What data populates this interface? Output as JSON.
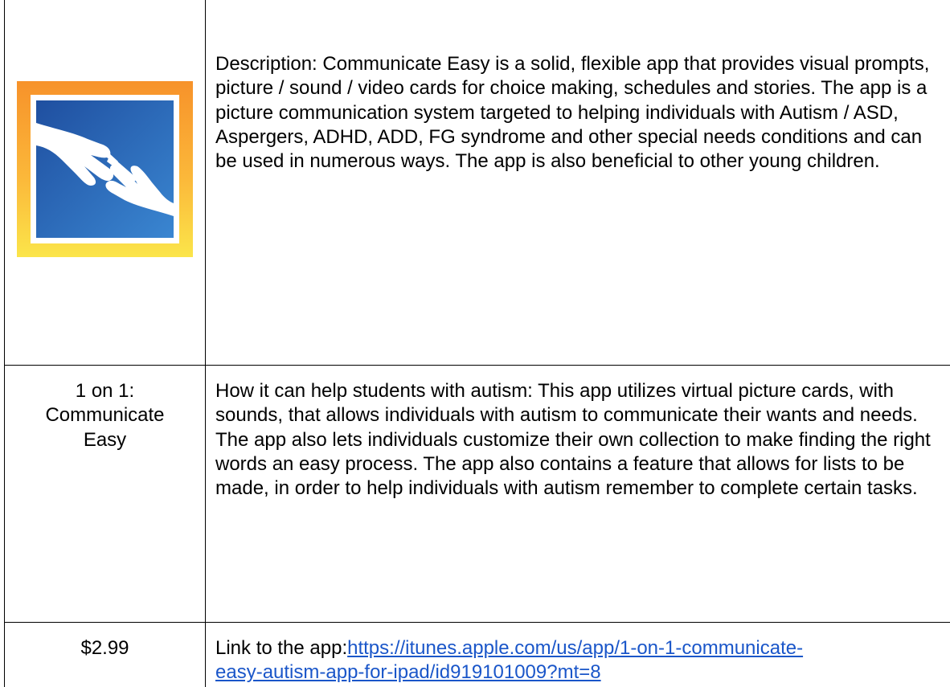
{
  "row1": {
    "icon": "communicate-easy-app-icon",
    "description": "Description: Communicate Easy is a solid, flexible app that provides visual prompts, picture / sound / video cards for choice making, schedules and stories. The app is a picture communication system targeted to helping individuals with Autism / ASD, Aspergers, ADHD, ADD, FG syndrome and other special needs conditions and can be used in numerous ways. The app is also beneficial to other young children."
  },
  "row2": {
    "app_name_line1": "1 on 1:",
    "app_name_line2": "Communicate",
    "app_name_line3": "Easy",
    "how_it_helps": "How it can help students with autism: This app utilizes virtual picture cards, with sounds, that allows individuals with autism to communicate their wants and needs. The app also lets individuals customize their own collection to make finding the right words an easy process. The app also contains a feature that allows for lists to be made, in order to help individuals with autism remember to complete certain tasks."
  },
  "row3": {
    "price": "$2.99",
    "link_label": "Link to the app:",
    "link_url_part1": "https://itunes.apple.com/us/app/1-on-1-communicate-",
    "link_url_part2": "easy-autism-app-for-ipad/id919101009?mt=8"
  },
  "colors": {
    "icon_gradient_top": "#f7922a",
    "icon_gradient_bottom": "#fbe54a",
    "icon_blue_top": "#1f4fa0",
    "icon_blue_bottom": "#3a86d1",
    "link": "#1a56c9"
  }
}
